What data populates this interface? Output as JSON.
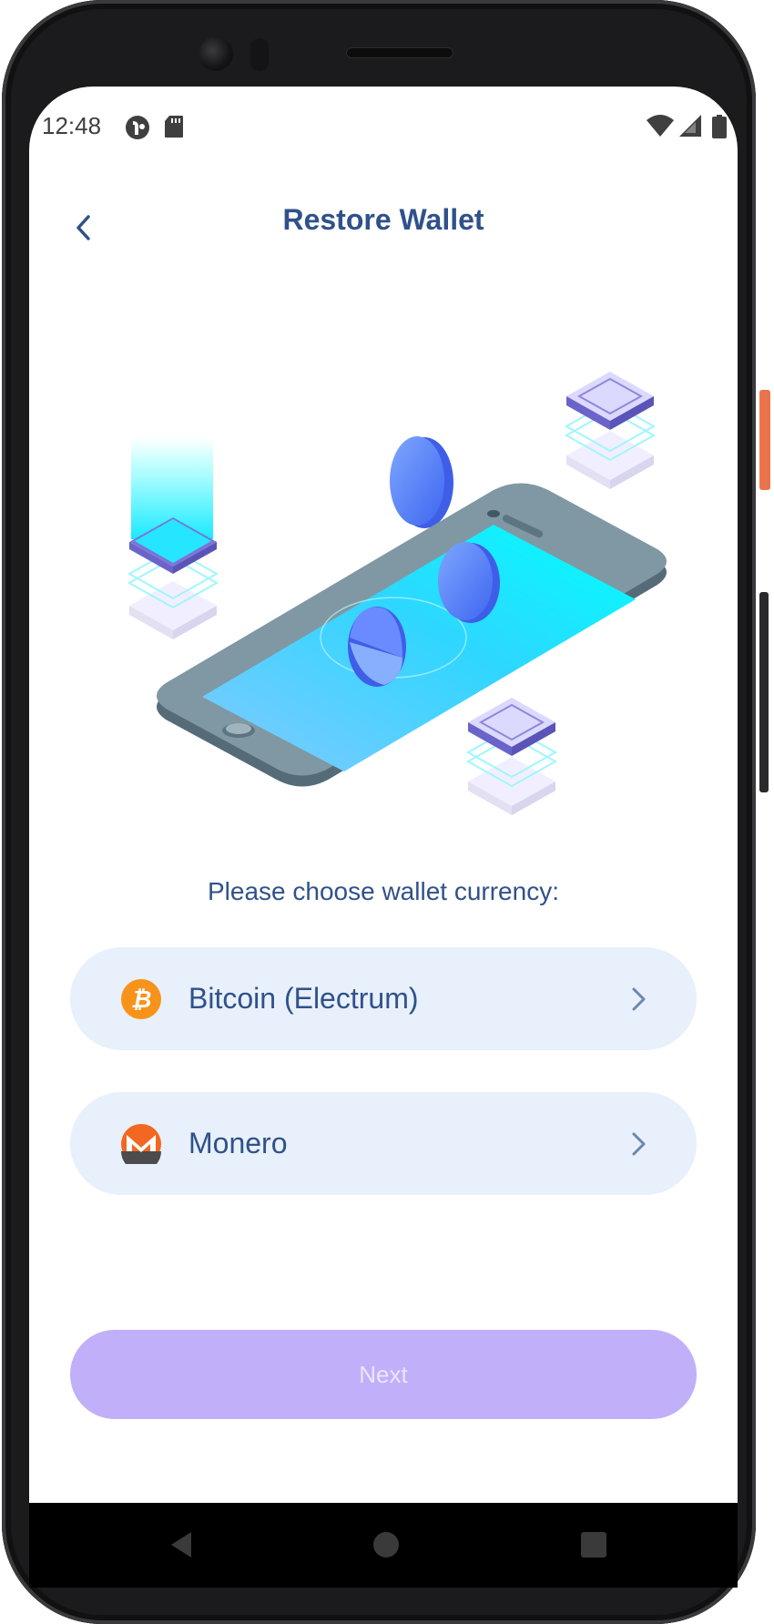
{
  "status_bar": {
    "time": "12:48",
    "left_icons": [
      "app-notification-icon",
      "sd-card-icon"
    ],
    "right_icons": [
      "wifi-icon",
      "cellular-signal-icon",
      "battery-icon"
    ]
  },
  "header": {
    "back_icon": "chevron-left-icon",
    "title": "Restore Wallet"
  },
  "illustration": {
    "description_icon": "phone-crypto-illustration"
  },
  "prompt": "Please choose wallet currency:",
  "currencies": [
    {
      "label": "Bitcoin (Electrum)",
      "icon": "bitcoin-icon",
      "icon_color": "#f7931a"
    },
    {
      "label": "Monero",
      "icon": "monero-icon",
      "icon_color": "#f26822"
    }
  ],
  "next_button": {
    "label": "Next",
    "enabled": false
  },
  "nav_bar": {
    "items": [
      "back-triangle-icon",
      "home-circle-icon",
      "recents-square-icon"
    ]
  },
  "colors": {
    "accent": "#30518a",
    "option_background": "#e8f0fb",
    "button_disabled": "#c1aff9",
    "screen_cyan": "#00ffff"
  }
}
